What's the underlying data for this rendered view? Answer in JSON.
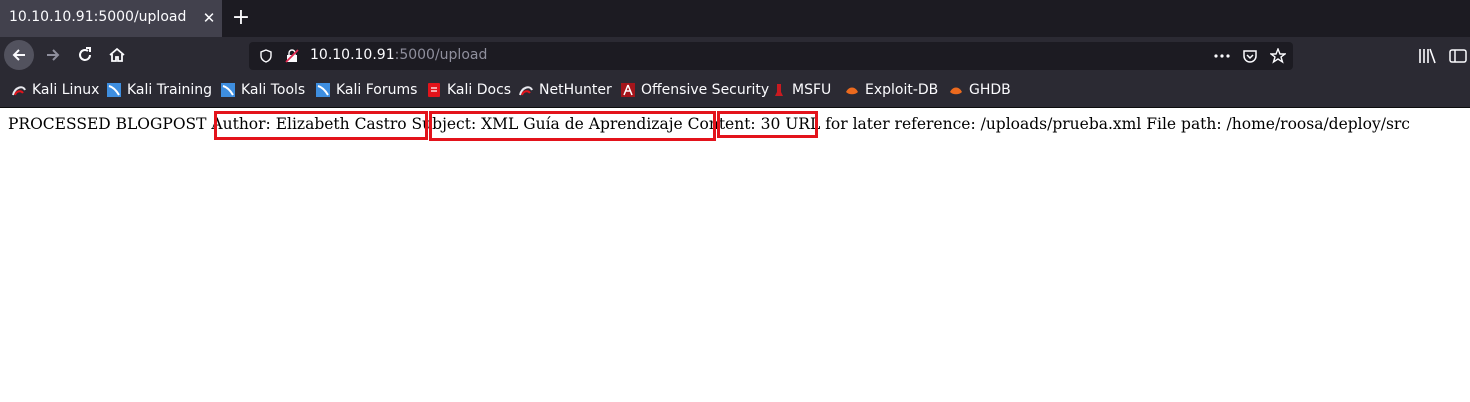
{
  "tab": {
    "title": "10.10.10.91:5000/upload",
    "close": "✕",
    "new_tab": "+"
  },
  "urlbar": {
    "host": "10.10.10.91",
    "rest": ":5000/upload"
  },
  "bookmarks": [
    {
      "label": "Kali Linux",
      "icon": "kali-dragon-icon"
    },
    {
      "label": "Kali Training",
      "icon": "kali-training-icon"
    },
    {
      "label": "Kali Tools",
      "icon": "kali-tools-icon"
    },
    {
      "label": "Kali Forums",
      "icon": "kali-forums-icon"
    },
    {
      "label": "Kali Docs",
      "icon": "kali-docs-icon"
    },
    {
      "label": "NetHunter",
      "icon": "nethunter-icon"
    },
    {
      "label": "Offensive Security",
      "icon": "offensive-security-icon"
    },
    {
      "label": "MSFU",
      "icon": "msfu-icon"
    },
    {
      "label": "Exploit-DB",
      "icon": "exploit-db-icon"
    },
    {
      "label": "GHDB",
      "icon": "ghdb-icon"
    }
  ],
  "page": {
    "prefix": "PROCESSED BLOGPOST ",
    "author": "Author: Elizabeth Castro",
    "subject": "Subject: XML Guía de Aprendizaje",
    "content": "Content: 30",
    "suffix": " URL for later reference: /uploads/prueba.xml File path: /home/roosa/deploy/src"
  },
  "colors": {
    "highlight": "#e3131b",
    "toolbar": "#2b2a33",
    "tabstrip": "#1c1b22"
  }
}
